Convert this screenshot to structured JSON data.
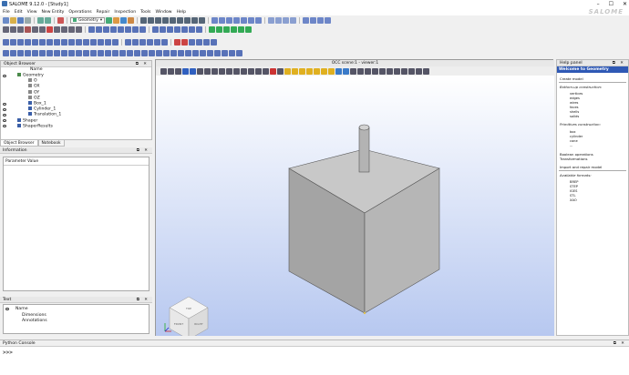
{
  "window": {
    "title": "SALOME 9.12.0 - [Study1]",
    "minimize": "–",
    "maximize": "☐",
    "close": "✕"
  },
  "menu": [
    "File",
    "Edit",
    "View",
    "New Entity",
    "Operations",
    "Repair",
    "Inspection",
    "Tools",
    "Window",
    "Help"
  ],
  "brand": "SALOME",
  "module_combo": "Geometry",
  "object_browser": {
    "title": "Object Browser",
    "column": "Name",
    "items": [
      {
        "label": "Geometry",
        "depth": 0
      },
      {
        "label": "O",
        "depth": 1
      },
      {
        "label": "OX",
        "depth": 1
      },
      {
        "label": "OY",
        "depth": 1
      },
      {
        "label": "OZ",
        "depth": 1
      },
      {
        "label": "Box_1",
        "depth": 1
      },
      {
        "label": "Cylinder_1",
        "depth": 1
      },
      {
        "label": "Translation_1",
        "depth": 1
      },
      {
        "label": "Shaper",
        "depth": 0
      },
      {
        "label": "ShaperResults",
        "depth": 0
      }
    ]
  },
  "tabs": [
    "Object Browser",
    "Notebook"
  ],
  "information": {
    "title": "Information",
    "columns": [
      "Parameter",
      "Value"
    ]
  },
  "text_panel": {
    "title": "Text",
    "column": "Name",
    "items": [
      "Dimensions",
      "Annotations"
    ]
  },
  "viewer": {
    "title": "OCC scene:1 - viewer:1",
    "cube_faces": {
      "top": "TOP",
      "front": "FRONT",
      "right": "RIGHT"
    }
  },
  "help": {
    "title": "Help panel",
    "header": "Welcome to Geometry",
    "create_model": "Create model",
    "bottom_up": "Bottom-up construction:",
    "bottom_up_items": [
      "vertices",
      "edges",
      "wires",
      "faces",
      "shells",
      "solids"
    ],
    "primitives": "Primitives construction:",
    "primitive_items": [
      "box",
      "cylinder",
      "cone",
      "..."
    ],
    "boolean": "Boolean operations",
    "transform": "Transformations",
    "import": "Import and repair model",
    "formats": "Available formats:",
    "format_items": [
      "BREP",
      "STEP",
      "IGES",
      "STL",
      "XAO"
    ]
  },
  "python_console": {
    "title": "Python Console",
    "prompt": ">>>"
  },
  "colors": {
    "accent": "#2f59b5",
    "viewer_bottom": "#b7c8f0",
    "shape": "#b3b3b3"
  }
}
